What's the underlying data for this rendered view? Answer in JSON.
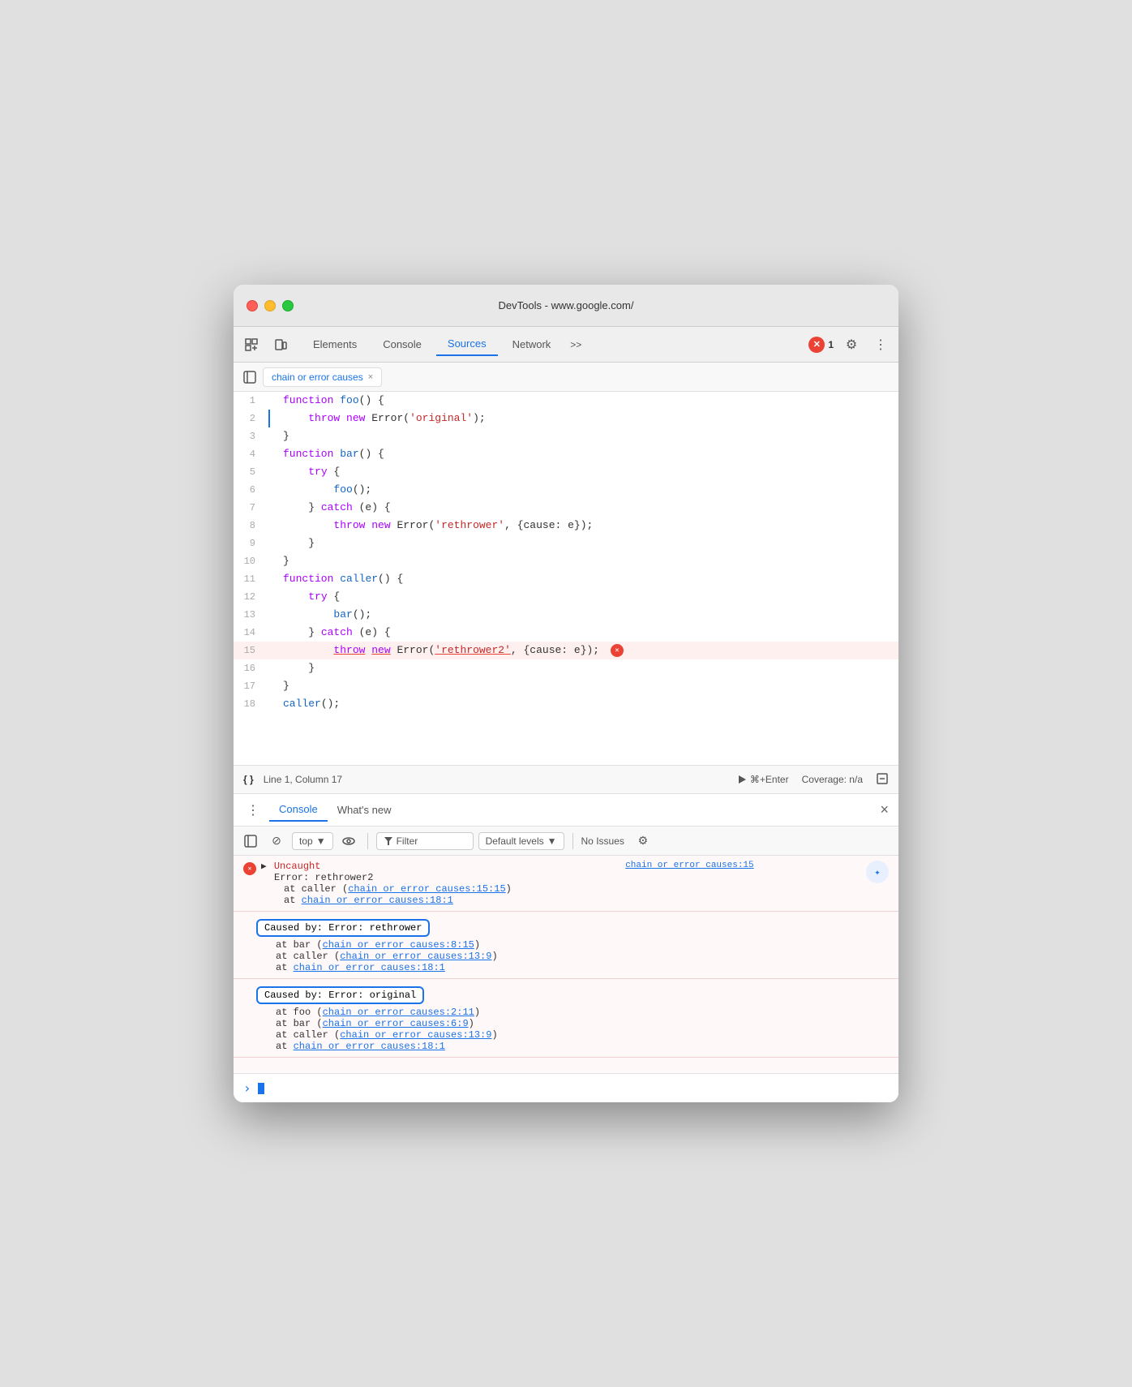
{
  "window": {
    "title": "DevTools - www.google.com/"
  },
  "tabs": {
    "elements": "Elements",
    "console": "Console",
    "sources": "Sources",
    "network": "Network",
    "more": ">>"
  },
  "error_count": "1",
  "subtab": {
    "label": "chain or error causes",
    "close": "×"
  },
  "code": {
    "lines": [
      {
        "num": 1,
        "content": "function foo() {"
      },
      {
        "num": 2,
        "content": "    throw new Error('original');"
      },
      {
        "num": 3,
        "content": "}"
      },
      {
        "num": 4,
        "content": "function bar() {"
      },
      {
        "num": 5,
        "content": "    try {"
      },
      {
        "num": 6,
        "content": "        foo();"
      },
      {
        "num": 7,
        "content": "    } catch (e) {"
      },
      {
        "num": 8,
        "content": "        throw new Error('rethrower', {cause: e});"
      },
      {
        "num": 9,
        "content": "    }"
      },
      {
        "num": 10,
        "content": "}"
      },
      {
        "num": 11,
        "content": "function caller() {"
      },
      {
        "num": 12,
        "content": "    try {"
      },
      {
        "num": 13,
        "content": "        bar();"
      },
      {
        "num": 14,
        "content": "    } catch (e) {"
      },
      {
        "num": 15,
        "content": "        throw new Error('rethrower2', {cause: e});",
        "error": true
      },
      {
        "num": 16,
        "content": "    }"
      },
      {
        "num": 17,
        "content": "}"
      },
      {
        "num": 18,
        "content": "caller();"
      }
    ]
  },
  "status_bar": {
    "format": "{ }",
    "position": "Line 1, Column 17",
    "run": "⌘+Enter",
    "coverage": "Coverage: n/a"
  },
  "console": {
    "tabs": [
      "Console",
      "What's new"
    ],
    "toolbar": {
      "top": "top",
      "filter_placeholder": "Filter",
      "default_levels": "Default levels",
      "no_issues": "No Issues"
    },
    "entries": [
      {
        "type": "error",
        "uncaught_label": "▶ Uncaught",
        "source_link": "chain or error causes:15",
        "lines": [
          "Error: rethrower2",
          "    at caller (chain or error causes:15:15)",
          "    at chain or error causes:18:1"
        ]
      },
      {
        "caused_by": "Caused by: Error: rethrower",
        "lines": [
          "    at bar (chain or error causes:8:15)",
          "    at caller (chain or error causes:13:9)",
          "    at chain or error causes:18:1"
        ]
      },
      {
        "caused_by": "Caused by: Error: original",
        "lines": [
          "    at foo (chain or error causes:2:11)",
          "    at bar (chain or error causes:6:9)",
          "    at caller (chain or error causes:13:9)",
          "    at chain or error causes:18:1"
        ]
      }
    ],
    "links": {
      "causes_15_15": "chain or error causes:15:15",
      "causes_18_1_a": "chain or error causes:18:1",
      "causes_8_15": "chain or error causes:8:15",
      "causes_13_9_a": "chain or error causes:13:9",
      "causes_18_1_b": "chain or error causes:18:1",
      "causes_2_11": "chain or error causes:2:11",
      "causes_6_9": "chain or error causes:6:9",
      "causes_13_9_b": "chain or error causes:13:9",
      "causes_18_1_c": "chain or error causes:18:1",
      "top_source": "chain or error causes:15"
    }
  }
}
